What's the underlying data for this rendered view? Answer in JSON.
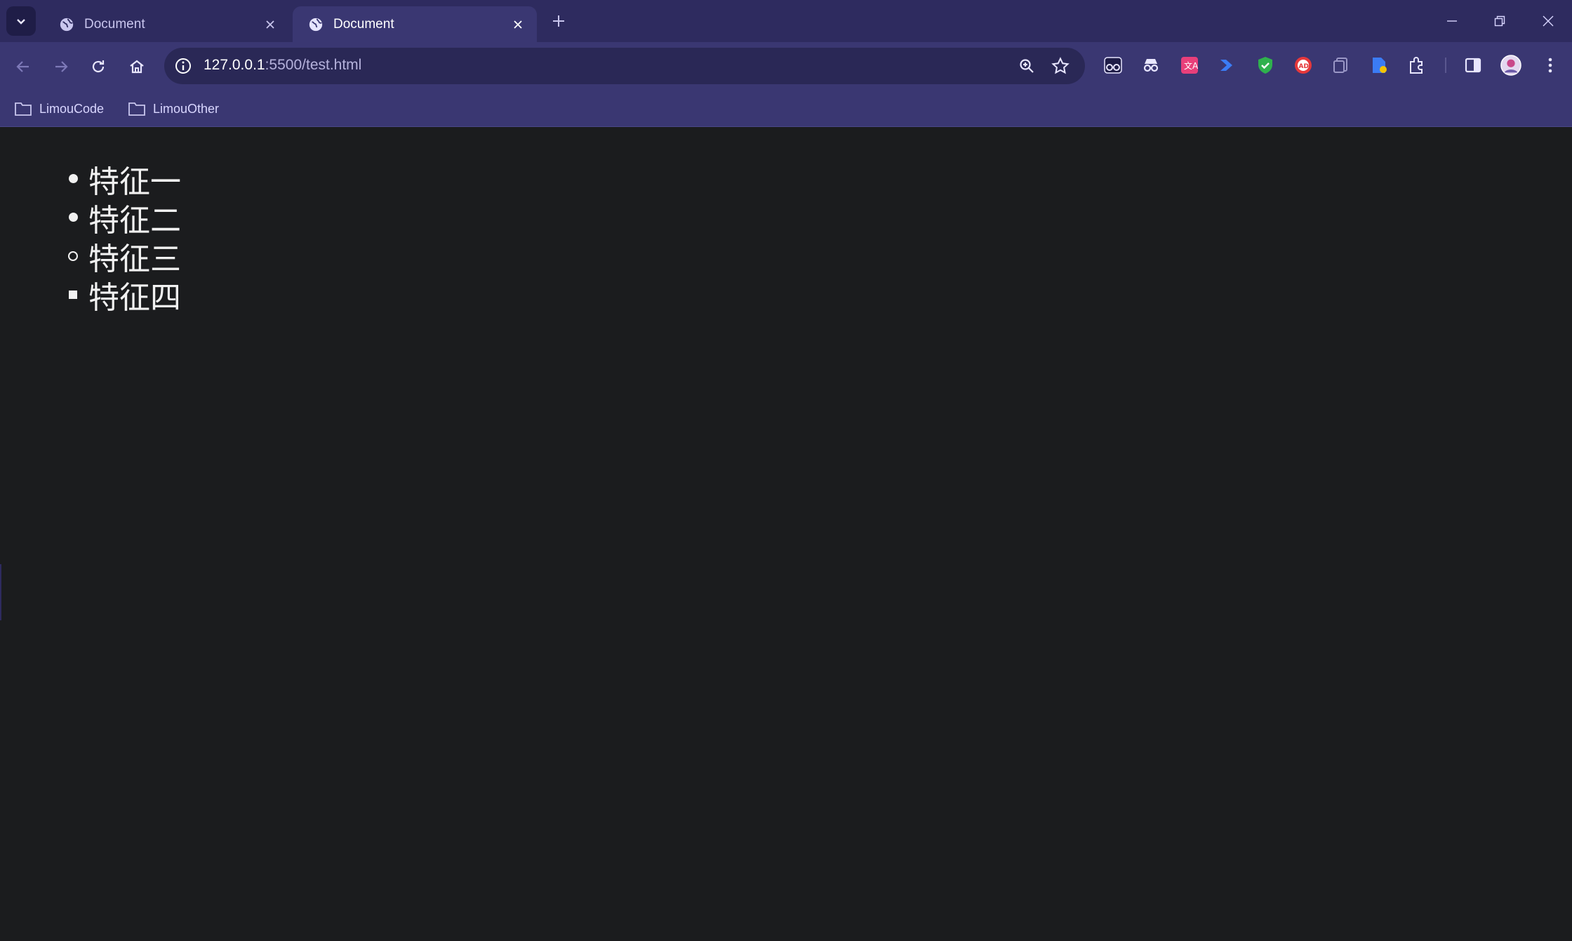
{
  "tabs": [
    {
      "title": "Document",
      "active": false
    },
    {
      "title": "Document",
      "active": true
    }
  ],
  "address": {
    "host": "127.0.0.1",
    "path": ":5500/test.html"
  },
  "bookmarks": [
    {
      "label": "LimouCode",
      "icon": "folder-icon"
    },
    {
      "label": "LimouOther",
      "icon": "folder-icon"
    }
  ],
  "page": {
    "list": [
      {
        "text": "特征一",
        "marker": "disc"
      },
      {
        "text": "特征二",
        "marker": "disc"
      },
      {
        "text": "特征三",
        "marker": "circle"
      },
      {
        "text": "特征四",
        "marker": "square"
      }
    ]
  },
  "colors": {
    "chrome": "#2e2b5f",
    "toolbar": "#3a3772",
    "page_bg": "#1b1c1e",
    "text": "#f1f1f1"
  }
}
